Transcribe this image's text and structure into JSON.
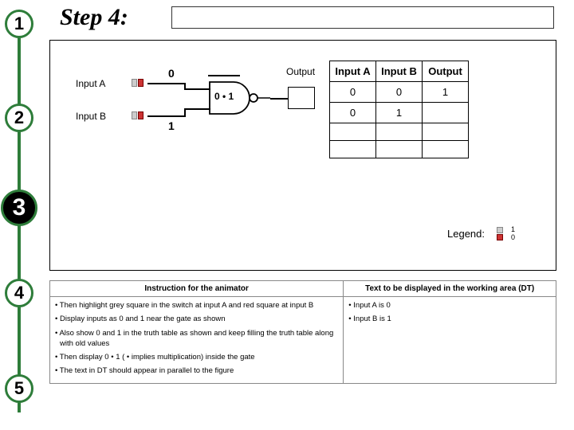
{
  "step_title": "Step 4:",
  "markers": [
    "1",
    "2",
    "3",
    "4",
    "5"
  ],
  "inputs": {
    "a_label": "Input A",
    "b_label": "Input B"
  },
  "gate_vals": {
    "top": "0",
    "bottom": "1",
    "inner": "0 • 1"
  },
  "output_label": "Output",
  "truth_table": {
    "headers": [
      "Input A",
      "Input B",
      "Output"
    ],
    "rows": [
      [
        "0",
        "0",
        "1"
      ],
      [
        "0",
        "1",
        ""
      ],
      [
        "",
        "",
        ""
      ],
      [
        "",
        "",
        ""
      ]
    ]
  },
  "legend": {
    "label": "Legend:",
    "top": "1",
    "bot": "0"
  },
  "bottom": {
    "header_left": "Instruction for the animator",
    "header_right": "Text to be displayed in the working area (DT)",
    "left_items": [
      "Then highlight grey square in the switch at input A and red square at input B",
      "Display inputs as 0 and 1 near the gate as shown",
      "Also show 0 and 1 in the truth table as shown and keep filling the truth table along with old values",
      "Then display 0 • 1 ( • implies multiplication) inside the gate",
      "The text in DT should appear in parallel to the figure"
    ],
    "right_items": [
      "Input A is 0",
      "Input B is 1"
    ]
  }
}
